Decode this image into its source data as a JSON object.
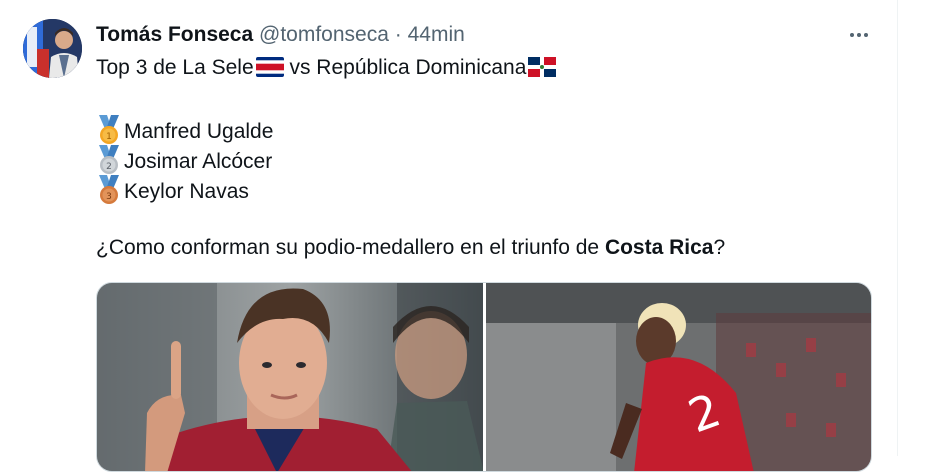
{
  "tweet": {
    "author_name": "Tomás Fonseca",
    "author_handle": "@tomfonseca",
    "separator": "·",
    "timestamp": "44min",
    "line1_prefix": "Top 3 de La Sele",
    "line1_middle": " vs República Dominicana",
    "ranking": [
      {
        "medal": "gold-medal-icon",
        "name": "Manfred Ugalde"
      },
      {
        "medal": "silver-medal-icon",
        "name": "Josimar Alcócer"
      },
      {
        "medal": "bronze-medal-icon",
        "name": "Keylor Navas"
      }
    ],
    "question_prefix": "¿Como conforman su podio-medallero en el triunfo de ",
    "question_bold": "Costa Rica",
    "question_suffix": "?"
  },
  "icons": {
    "more": "more-options-icon",
    "flag_cr": "costa-rica-flag-icon",
    "flag_do": "dominican-republic-flag-icon"
  },
  "colors": {
    "text": "#0f1419",
    "secondary": "#536471",
    "gold": "#f4a623",
    "silver": "#b8bec4",
    "bronze": "#d57a3c",
    "ribbon": "#5b9bd5",
    "cr_red": "#ce1126",
    "cr_blue": "#002b7f",
    "do_blue": "#002d62",
    "do_red": "#ce1126"
  }
}
